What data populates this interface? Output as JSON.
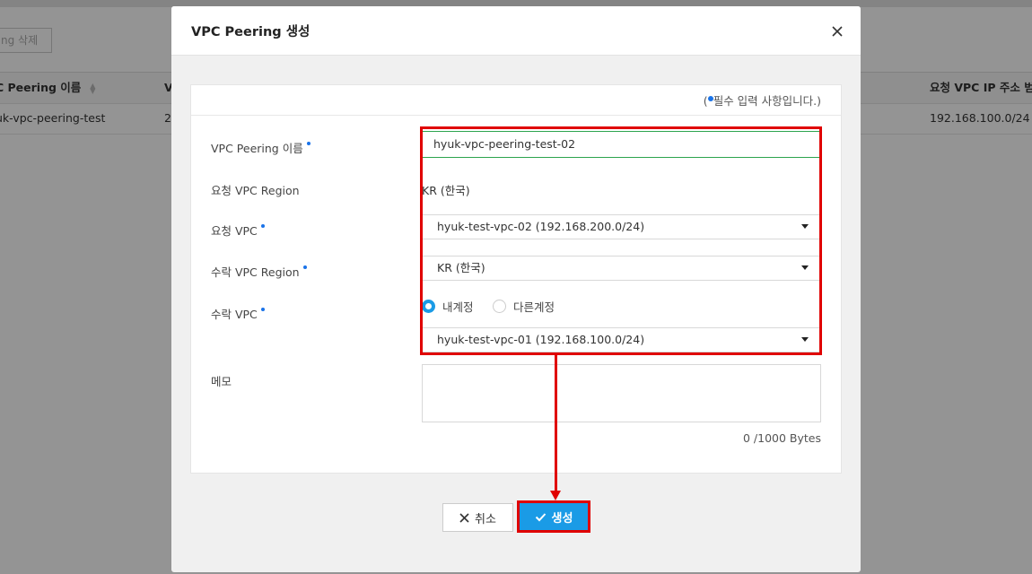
{
  "background": {
    "delete_button": "ng 삭제",
    "columns": {
      "peering_name": "C Peering 이름",
      "v": "V",
      "request_vpc_ip": "요청 VPC IP 주소 범위"
    },
    "row": {
      "peering_name": "uk-vpc-peering-test",
      "v": "2",
      "request_vpc_ip": "192.168.100.0/24"
    }
  },
  "modal": {
    "title": "VPC Peering 생성",
    "required_note_open": "(",
    "required_note_text": "필수 입력 사항입니다.)",
    "fields": {
      "peering_name_label": "VPC Peering 이름",
      "peering_name_value": "hyuk-vpc-peering-test-02",
      "request_region_label": "요청 VPC Region",
      "request_region_value": "KR (한국)",
      "request_vpc_label": "요청 VPC",
      "request_vpc_value": "hyuk-test-vpc-02 (192.168.200.0/24)",
      "accept_region_label": "수락 VPC Region",
      "accept_region_value": "KR (한국)",
      "accept_vpc_label": "수락 VPC",
      "radio_own": "내계정",
      "radio_other": "다른계정",
      "accept_vpc_value": "hyuk-test-vpc-01 (192.168.100.0/24)",
      "memo_label": "메모",
      "memo_value": "",
      "byte_count": "0 /1000 Bytes"
    },
    "buttons": {
      "cancel": "취소",
      "create": "생성"
    }
  },
  "colors": {
    "accent": "#1a9be6",
    "highlight": "#e00000",
    "required_dot": "#1a73e8"
  }
}
